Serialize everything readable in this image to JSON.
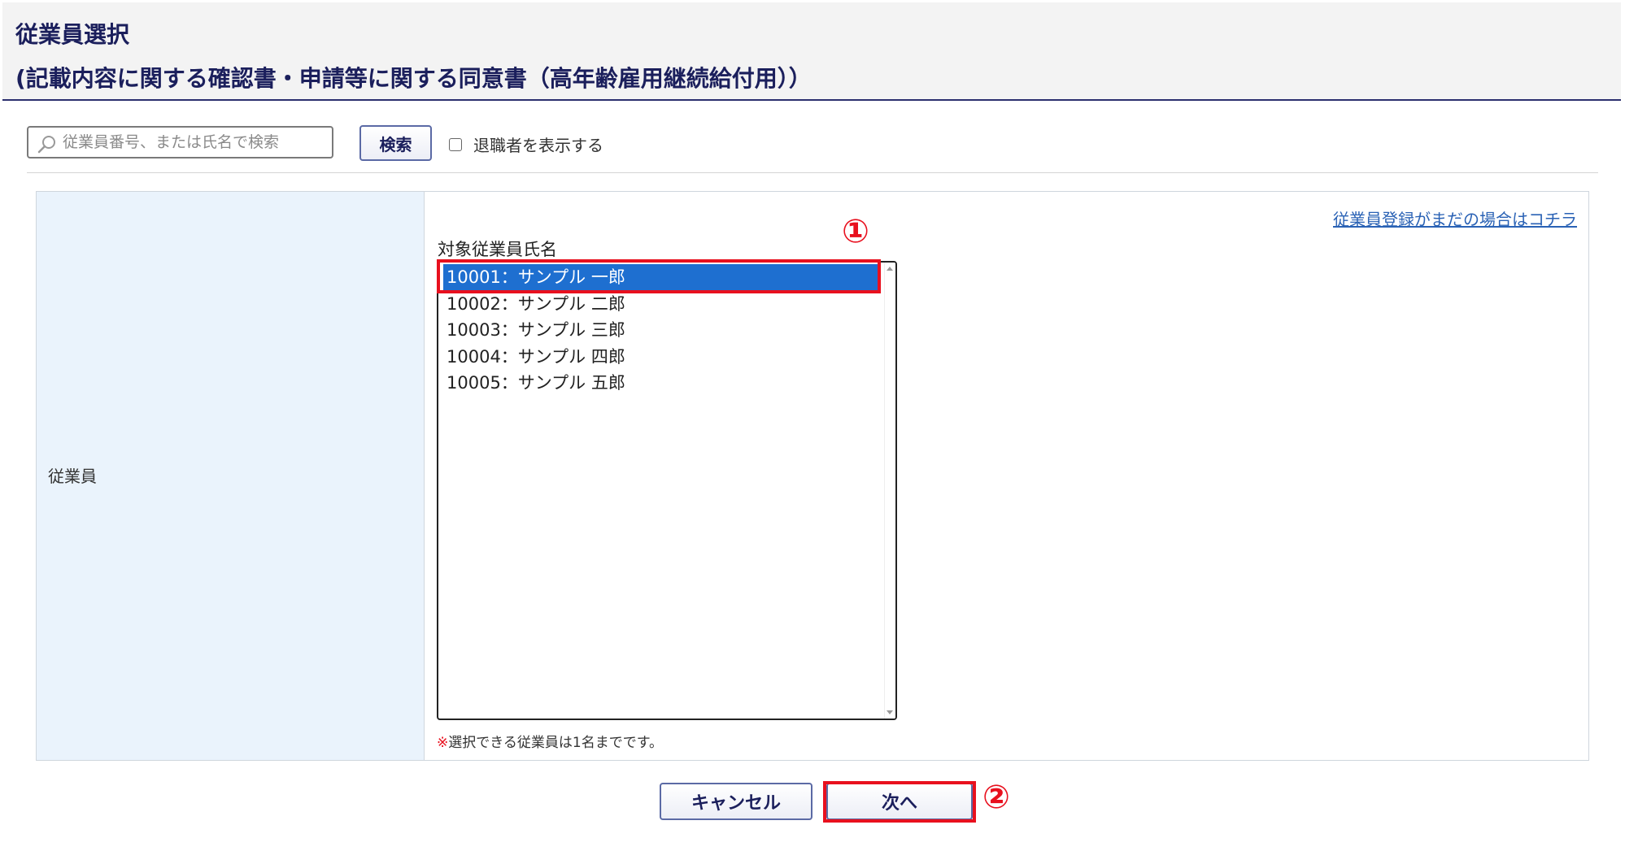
{
  "header": {
    "title": "従業員選択",
    "subtitle": "(記載内容に関する確認書・申請等に関する同意書（高年齢雇用継続給付用））"
  },
  "search": {
    "placeholder": "従業員番号、または氏名で検索",
    "value": "",
    "button_label": "検索",
    "show_retired_label": "退職者を表示する",
    "show_retired_checked": false
  },
  "form": {
    "row_label": "従業員",
    "register_link": "従業員登録がまだの場合はコチラ",
    "list_label": "対象従業員氏名",
    "options": [
      "10001：サンプル 一郎",
      "10002：サンプル 二郎",
      "10003：サンプル 三郎",
      "10004：サンプル 四郎",
      "10005：サンプル 五郎"
    ],
    "selected_index": 0,
    "note_mark": "※",
    "note_text": "選択できる従業員は1名までです。"
  },
  "footer": {
    "cancel_label": "キャンセル",
    "next_label": "次へ"
  },
  "annotations": {
    "marker_1": "①",
    "marker_2": "②"
  },
  "colors": {
    "accent": "#1b1f5c",
    "selected": "#1e6fd0",
    "highlight": "#e8101e",
    "label_bg": "#eaf3fc",
    "link": "#2a62b5"
  }
}
